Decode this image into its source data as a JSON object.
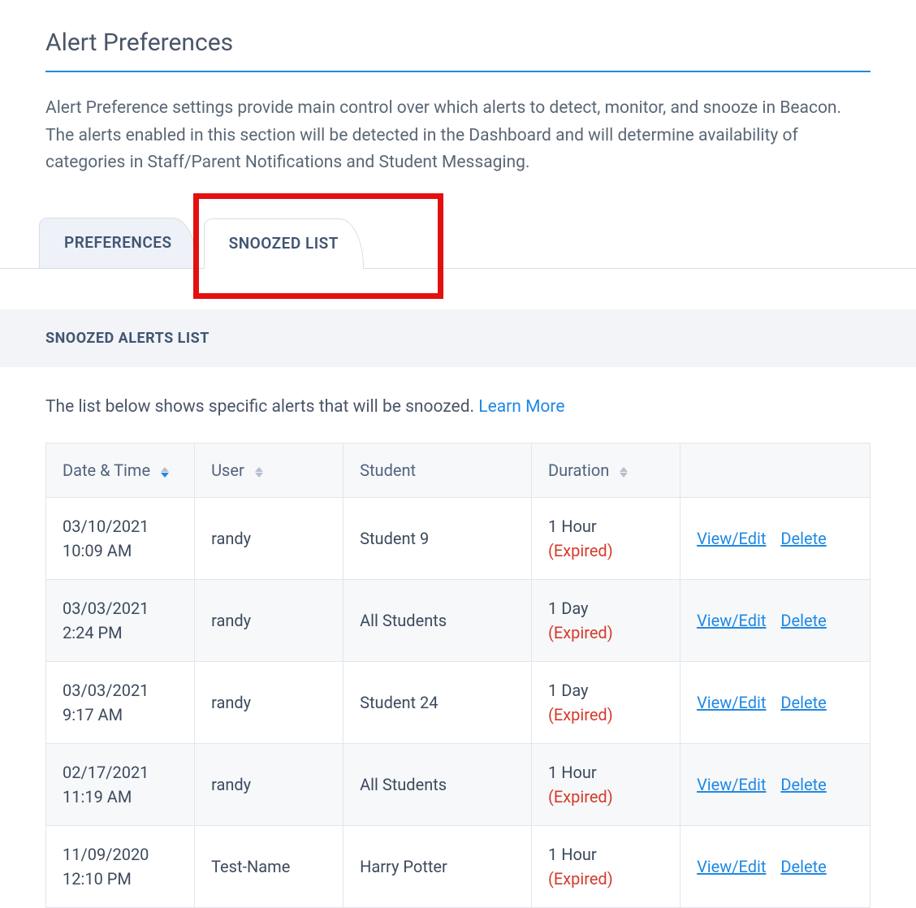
{
  "page": {
    "title": "Alert Preferences",
    "description": "Alert Preference settings provide main control over which alerts to detect, monitor, and snooze in Beacon. The alerts enabled in this section will be detected in the Dashboard and will determine availability of categories in Staff/Parent Notifications and Student Messaging."
  },
  "tabs": {
    "preferences": "PREFERENCES",
    "snoozed_list": "SNOOZED LIST",
    "active": "snoozed_list"
  },
  "section": {
    "header": "SNOOZED ALERTS LIST",
    "description": "The list below shows specific alerts that will be snoozed. ",
    "learn_more": "Learn More"
  },
  "table": {
    "columns": {
      "date_time": "Date & Time",
      "user": "User",
      "student": "Student",
      "duration": "Duration"
    },
    "actions": {
      "view_edit": "View/Edit",
      "delete": "Delete"
    },
    "expired_label": "(Expired)",
    "rows": [
      {
        "date": "03/10/2021",
        "time": "10:09 AM",
        "user": "randy",
        "student": "Student 9",
        "duration": "1 Hour",
        "expired": true
      },
      {
        "date": "03/03/2021",
        "time": "2:24 PM",
        "user": "randy",
        "student": "All Students",
        "duration": "1 Day",
        "expired": true
      },
      {
        "date": "03/03/2021",
        "time": "9:17 AM",
        "user": "randy",
        "student": "Student 24",
        "duration": "1 Day",
        "expired": true
      },
      {
        "date": "02/17/2021",
        "time": "11:19 AM",
        "user": "randy",
        "student": "All Students",
        "duration": "1 Hour",
        "expired": true
      },
      {
        "date": "11/09/2020",
        "time": "12:10 PM",
        "user": "Test-Name",
        "student": "Harry Potter",
        "duration": "1 Hour",
        "expired": true
      }
    ]
  }
}
